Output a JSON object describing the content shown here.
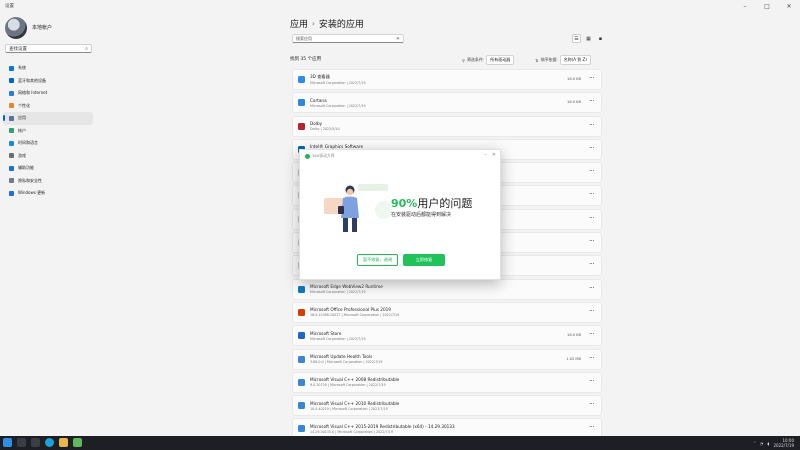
{
  "window": {
    "app_title": "设置"
  },
  "profile": {
    "name": "本地帐户",
    "subtitle": ""
  },
  "sidebar": {
    "find_placeholder": "查找设置",
    "items": [
      {
        "label": "系统",
        "color": "#0078d4"
      },
      {
        "label": "蓝牙和其他设备",
        "color": "#0067c0"
      },
      {
        "label": "网络和 Internet",
        "color": "#2d7fd3"
      },
      {
        "label": "个性化",
        "color": "#e08a2a"
      },
      {
        "label": "应用",
        "color": "#5b6fa7",
        "active": true
      },
      {
        "label": "帐户",
        "color": "#2fa36b"
      },
      {
        "label": "时间和语言",
        "color": "#1f8ad1"
      },
      {
        "label": "游戏",
        "color": "#6d6d6d"
      },
      {
        "label": "辅助功能",
        "color": "#1a73c8"
      },
      {
        "label": "隐私和安全性",
        "color": "#6f7b86"
      },
      {
        "label": "Windows 更新",
        "color": "#1e6fd9"
      }
    ]
  },
  "main": {
    "breadcrumb": [
      "应用",
      "安装的应用"
    ],
    "breadcrumb_sep": "›",
    "search_placeholder": "搜索应用",
    "found_text": "找到 35 个应用",
    "filter_label": "筛选条件:",
    "filter_value": "所有驱动器",
    "sort_label": "排序依据:",
    "sort_value": "名称(A 到 Z)",
    "view_icons": [
      "list-view-icon",
      "grid-view-icon",
      "tile-view-icon"
    ],
    "apps": [
      {
        "name": "3D 查看器",
        "meta": "Microsoft Corporation | 2022/7/19",
        "size": "16.0 KB",
        "color": "#2d8cf0"
      },
      {
        "name": "Cortana",
        "meta": "Microsoft Corporation | 2022/7/19",
        "size": "16.0 KB",
        "color": "#2b88d8"
      },
      {
        "name": "Dolby",
        "meta": "Dolby | 2022/5/10",
        "size": "",
        "color": "#b3262b"
      },
      {
        "name": "Intel® Graphics Software",
        "meta": "Intel Corporation | 2022/7/19",
        "size": "",
        "color": "#0068b5"
      },
      {
        "name": "",
        "meta": "",
        "size": "",
        "color": "#c8c8c8"
      },
      {
        "name": "",
        "meta": "",
        "size": "",
        "color": "#c8c8c8"
      },
      {
        "name": "",
        "meta": "",
        "size": "",
        "color": "#c8c8c8"
      },
      {
        "name": "",
        "meta": "",
        "size": "",
        "color": "#c8c8c8"
      },
      {
        "name": "",
        "meta": "",
        "size": "",
        "color": "#c8c8c8"
      },
      {
        "name": "Microsoft Edge WebView2 Runtime",
        "meta": "Microsoft Corporation | 2022/7/19",
        "size": "",
        "color": "#0c7bbf"
      },
      {
        "name": "Microsoft Office Professional Plus 2019",
        "meta": "16.0.10388.20027 | Microsoft Corporation | 2022/7/19",
        "size": "",
        "color": "#d83b01"
      },
      {
        "name": "Microsoft Store",
        "meta": "Microsoft Corporation | 2022/7/19",
        "size": "16.0 KB",
        "color": "#1b6ac9"
      },
      {
        "name": "Microsoft Update Health Tools",
        "meta": "3.68.0.0 | Microsoft Corporation | 2022/7/19",
        "size": "1.02 MB",
        "color": "#3a86d4"
      },
      {
        "name": "Microsoft Visual C++ 2008 Redistributable",
        "meta": "9.0.30729 | Microsoft Corporation | 2022/7/19",
        "size": "",
        "color": "#3a86d4"
      },
      {
        "name": "Microsoft Visual C++ 2010 Redistributable",
        "meta": "10.0.40219 | Microsoft Corporation | 2022/7/19",
        "size": "",
        "color": "#3a86d4"
      },
      {
        "name": "Microsoft Visual C++ 2015-2019 Redistributable (x64) - 14.29.30133",
        "meta": "14.29.30133.0 | Microsoft Corporation | 2022/7/19",
        "size": "",
        "color": "#3a86d4"
      }
    ]
  },
  "dialog": {
    "header": "360驱动大师",
    "title_pct": "90%",
    "title_rest": "用户的问题",
    "subtitle": "在安装驱动后都能得到解决",
    "btn_later": "暂不修复，谢谢",
    "btn_now": "立即修复",
    "accent": "#22bb55"
  },
  "taskbar": {
    "icons": [
      "windows-start-icon",
      "search-icon",
      "task-view-icon",
      "edge-icon",
      "file-explorer-icon",
      "app-icon"
    ],
    "time": "10:00",
    "date": "2022/7/19"
  }
}
